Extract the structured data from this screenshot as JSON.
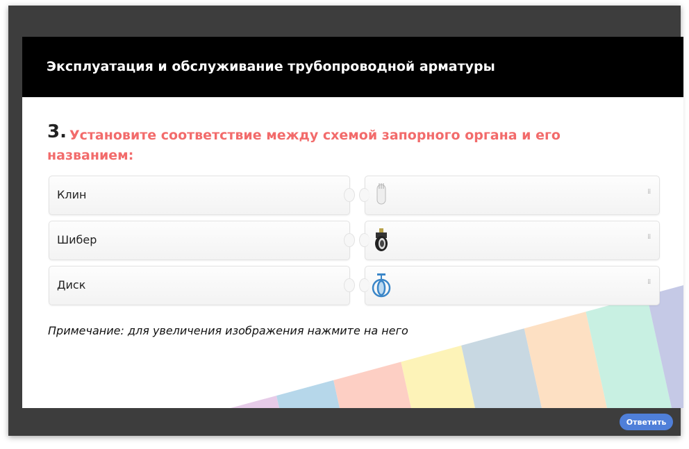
{
  "header": {
    "title": "Эксплуатация и обслуживание трубопроводной арматуры"
  },
  "question": {
    "number": "3.",
    "text": "Установите соответствие между схемой запорного органа и его названием:"
  },
  "pairs": [
    {
      "label": "Клин",
      "image": "wedge-gate-image"
    },
    {
      "label": "Шибер",
      "image": "slide-gate-image"
    },
    {
      "label": "Диск",
      "image": "disc-valve-image"
    }
  ],
  "note": "Примечание: для увеличения изображения нажмите на него",
  "footer": {
    "answer_label": "Ответить"
  },
  "colors": {
    "frame": "#3d3d3d",
    "question": "#f26b6b",
    "button": "#4f7fd9",
    "stripes": [
      "#e6cbe8",
      "#b6d7ea",
      "#fdcfc4",
      "#fdf3b8",
      "#c8d8e2",
      "#fde0c3",
      "#c8f0e2",
      "#c5c9e6"
    ]
  }
}
